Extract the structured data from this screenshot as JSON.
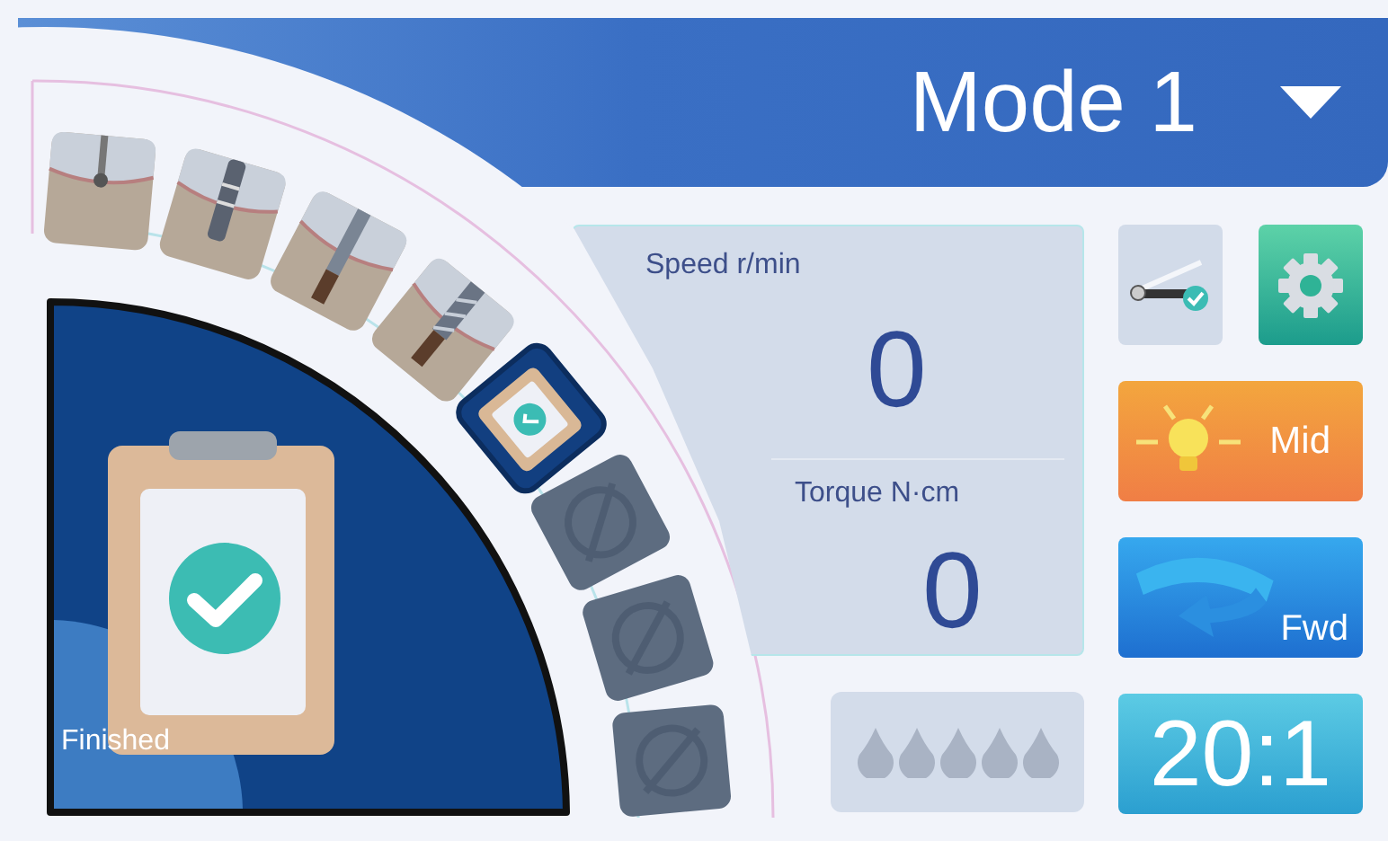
{
  "header": {
    "title": "Mode 1"
  },
  "steps": [
    {
      "kind": "bur",
      "selected": false,
      "disabled": false
    },
    {
      "kind": "driver",
      "selected": false,
      "disabled": false
    },
    {
      "kind": "drill",
      "selected": false,
      "disabled": false
    },
    {
      "kind": "tap",
      "selected": false,
      "disabled": false
    },
    {
      "kind": "finish",
      "selected": true,
      "disabled": false
    },
    {
      "kind": "blank",
      "selected": false,
      "disabled": true
    },
    {
      "kind": "blank",
      "selected": false,
      "disabled": true
    },
    {
      "kind": "blank",
      "selected": false,
      "disabled": true
    }
  ],
  "current_step": {
    "kind": "finish",
    "label": "Finished"
  },
  "speed": {
    "label": "Speed r/min",
    "value": "0"
  },
  "torque": {
    "label": "Torque N·cm",
    "value": "0"
  },
  "coolant": {
    "drops": [
      {
        "on": false
      },
      {
        "on": false
      },
      {
        "on": false
      },
      {
        "on": false
      },
      {
        "on": false
      }
    ]
  },
  "buttons": [
    {
      "kind": "calibrate"
    },
    {
      "kind": "settings"
    },
    {
      "kind": "light",
      "label": "Mid"
    },
    {
      "kind": "direction",
      "label": "Fwd"
    },
    {
      "kind": "ratio",
      "label": "20:1"
    }
  ]
}
